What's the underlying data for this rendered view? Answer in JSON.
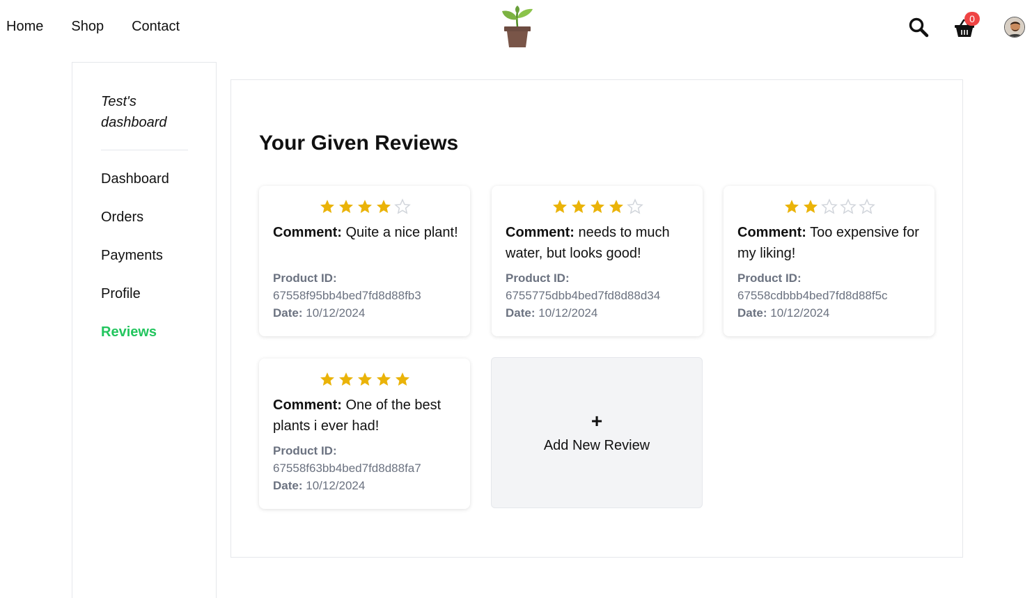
{
  "nav": {
    "links": [
      "Home",
      "Shop",
      "Contact"
    ],
    "cart_count": "0",
    "icons": {
      "logo": "plant-pot-icon",
      "search": "search-icon",
      "cart": "basket-icon",
      "avatar": "user-avatar"
    }
  },
  "sidebar": {
    "title": "Test's dashboard",
    "items": [
      {
        "label": "Dashboard",
        "active": false
      },
      {
        "label": "Orders",
        "active": false
      },
      {
        "label": "Payments",
        "active": false
      },
      {
        "label": "Profile",
        "active": false
      },
      {
        "label": "Reviews",
        "active": true
      }
    ]
  },
  "main": {
    "title": "Your Given Reviews",
    "comment_label": "Comment:",
    "product_label": "Product ID:",
    "date_label": "Date:",
    "reviews": [
      {
        "rating": 4,
        "comment": "Quite a nice plant!",
        "product_id": "67558f95bb4bed7fd8d88fb3",
        "date": "10/12/2024"
      },
      {
        "rating": 4,
        "comment": "needs to much water, but looks good!",
        "product_id": "6755775dbb4bed7fd8d88d34",
        "date": "10/12/2024"
      },
      {
        "rating": 2,
        "comment": "Too expensive for my liking!",
        "product_id": "67558cdbbb4bed7fd8d88f5c",
        "date": "10/12/2024"
      },
      {
        "rating": 5,
        "comment": "One of the best plants i ever had!",
        "product_id": "67558f63bb4bed7fd8d88fa7",
        "date": "10/12/2024"
      }
    ],
    "add_card": {
      "plus": "+",
      "label": "Add New Review"
    }
  },
  "colors": {
    "accent_green": "#22c55e",
    "star_filled": "#eab308",
    "star_empty": "#d1d5db",
    "badge_red": "#ef4444",
    "meta_gray": "#6b7280"
  }
}
